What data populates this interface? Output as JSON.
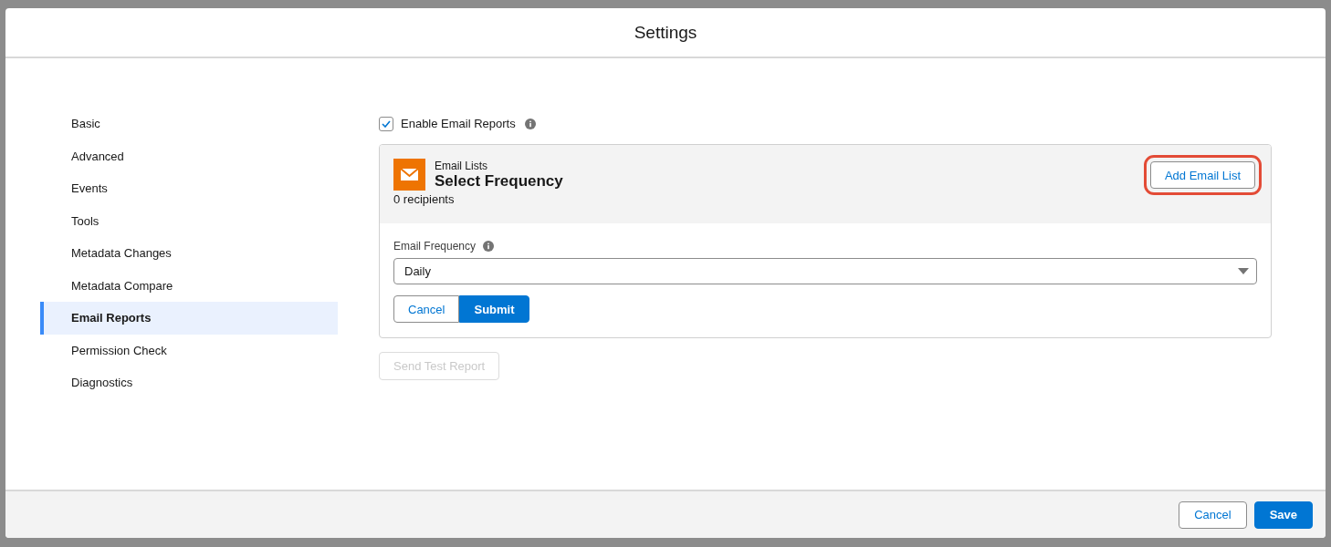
{
  "modal": {
    "title": "Settings"
  },
  "sidebar": {
    "items": [
      {
        "label": "Basic",
        "selected": false
      },
      {
        "label": "Advanced",
        "selected": false
      },
      {
        "label": "Events",
        "selected": false
      },
      {
        "label": "Tools",
        "selected": false
      },
      {
        "label": "Metadata Changes",
        "selected": false
      },
      {
        "label": "Metadata Compare",
        "selected": false
      },
      {
        "label": "Email Reports",
        "selected": true
      },
      {
        "label": "Permission Check",
        "selected": false
      },
      {
        "label": "Diagnostics",
        "selected": false
      }
    ]
  },
  "enable_checkbox": {
    "label": "Enable Email Reports",
    "checked": true
  },
  "card": {
    "eyebrow": "Email Lists",
    "title": "Select Frequency",
    "subtitle": "0 recipients",
    "add_button": {
      "label": "Add Email List",
      "highlighted": true
    },
    "frequency": {
      "label": "Email Frequency",
      "value": "Daily"
    },
    "buttons": [
      {
        "label": "Cancel",
        "kind": "neutral"
      },
      {
        "label": "Submit",
        "kind": "brand"
      }
    ]
  },
  "test_button": {
    "label": "Send Test Report",
    "disabled": true
  },
  "footer": {
    "buttons": [
      {
        "label": "Cancel",
        "kind": "neutral"
      },
      {
        "label": "Save",
        "kind": "brand"
      }
    ]
  }
}
